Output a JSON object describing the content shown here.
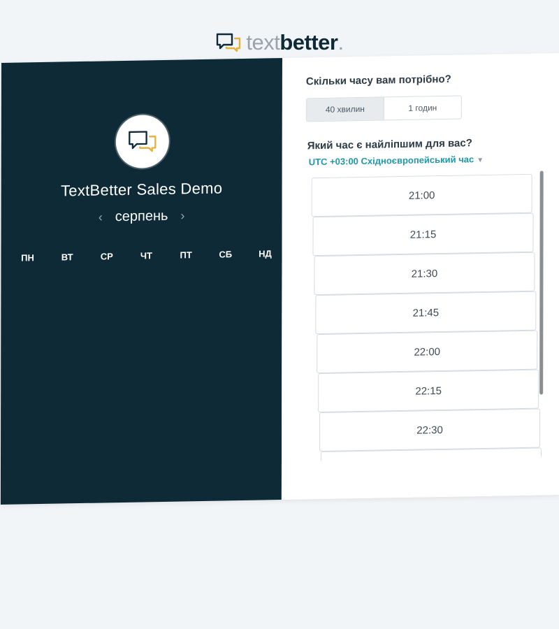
{
  "brand": {
    "light": "text",
    "bold": "better",
    "mark": "."
  },
  "left_panel": {
    "title": "TextBetter Sales Demo",
    "month": "серпень",
    "prev_icon": "chevron-left-icon",
    "next_icon": "chevron-right-icon",
    "weekdays": [
      "ПН",
      "ВТ",
      "СР",
      "ЧТ",
      "ПТ",
      "СБ",
      "НД"
    ]
  },
  "right_panel": {
    "question_duration": "Скільки часу вам потрібно?",
    "durations": [
      "40 хвилин",
      "1 годин"
    ],
    "question_time": "Який час є найліпшим для вас?",
    "timezone": "UTC +03:00 Східноєвропейський час",
    "slots": [
      "21:00",
      "21:15",
      "21:30",
      "21:45",
      "22:00",
      "22:15",
      "22:30",
      ""
    ]
  },
  "colors": {
    "left_bg": "#0e2a36",
    "accent": "#1f97a8",
    "logo_yellow": "#e2b23a"
  }
}
